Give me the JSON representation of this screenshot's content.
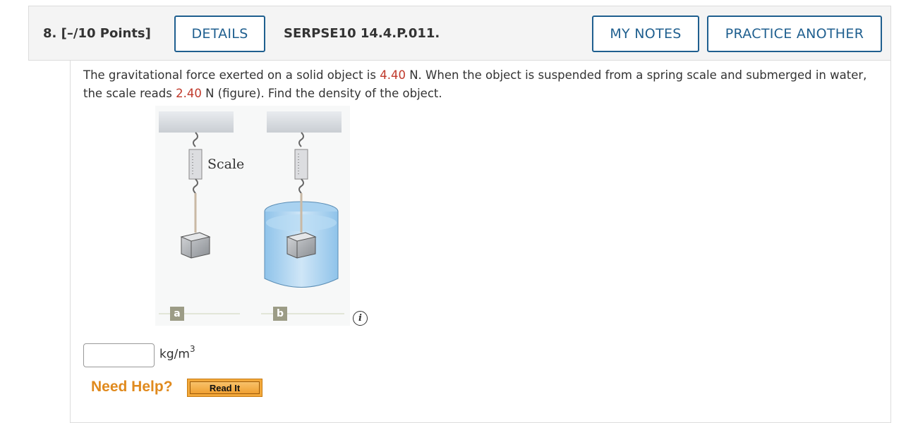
{
  "question": {
    "number": "8.",
    "points": "[–/10 Points]",
    "code": "SERPSE10 14.4.P.011."
  },
  "buttons": {
    "details": "DETAILS",
    "my_notes": "MY NOTES",
    "practice_another": "PRACTICE ANOTHER"
  },
  "prompt": {
    "part1": "The gravitational force exerted on a solid object is ",
    "value1": "4.40",
    "part2": " N. When the object is suspended from a spring scale and submerged in water, the scale reads ",
    "value2": "2.40",
    "part3": " N (figure). Find the density of the object.",
    "value_color": "#c0392b"
  },
  "figure": {
    "scale_label": "Scale",
    "panel_a": "a",
    "panel_b": "b",
    "info_icon": "info-icon",
    "info_glyph": "i"
  },
  "answer": {
    "value": "",
    "placeholder": "",
    "unit_base": "kg/m",
    "unit_exp": "3"
  },
  "help": {
    "label": "Need Help?",
    "read_it": "Read It"
  }
}
